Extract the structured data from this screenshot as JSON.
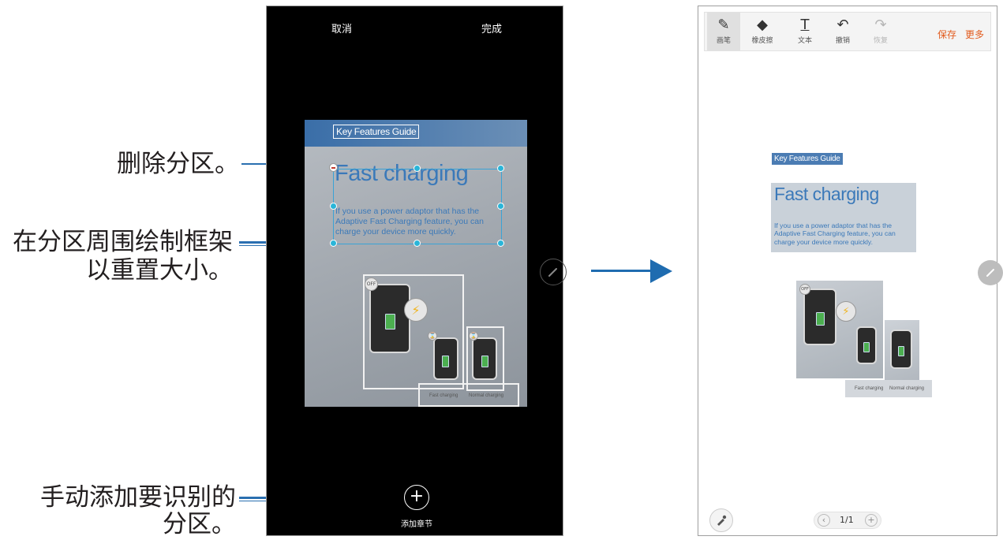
{
  "callouts": {
    "delete_section": "删除分区。",
    "resize_line1": "在分区周围绘制框架",
    "resize_line2": "以重置大小。",
    "add_line1": "手动添加要识别的",
    "add_line2": "分区。"
  },
  "left_screen": {
    "cancel": "取消",
    "done": "完成",
    "add_section_label": "添加章节",
    "add_icon": "plus-icon",
    "pen_icon": "pen-icon",
    "delete_icon": "minus-icon"
  },
  "document": {
    "header": "Key Features Guide",
    "title": "Fast charging",
    "body": "If you use a power adaptor that has the\nAdaptive Fast Charging feature, you can\ncharge your device more quickly.",
    "badge_off": "OFF",
    "caption_fast": "Fast charging",
    "caption_normal": "Normal charging"
  },
  "right_screen": {
    "tools": [
      {
        "label": "画笔",
        "icon": "pen-icon"
      },
      {
        "label": "橡皮擦",
        "icon": "eraser-icon"
      },
      {
        "label": "文本",
        "icon": "text-icon"
      },
      {
        "label": "撤销",
        "icon": "undo-icon"
      },
      {
        "label": "恢复",
        "icon": "redo-icon"
      }
    ],
    "save": "保存",
    "more": "更多",
    "page_indicator": "1/1",
    "prev_icon": "chevron-left-icon",
    "add_page_icon": "plus-icon",
    "bottom_left_icon": "pen-settings-icon"
  },
  "colors": {
    "accent_blue": "#2a6fb0",
    "handle_cyan": "#2ab5d8",
    "action_orange": "#e25a1c"
  }
}
